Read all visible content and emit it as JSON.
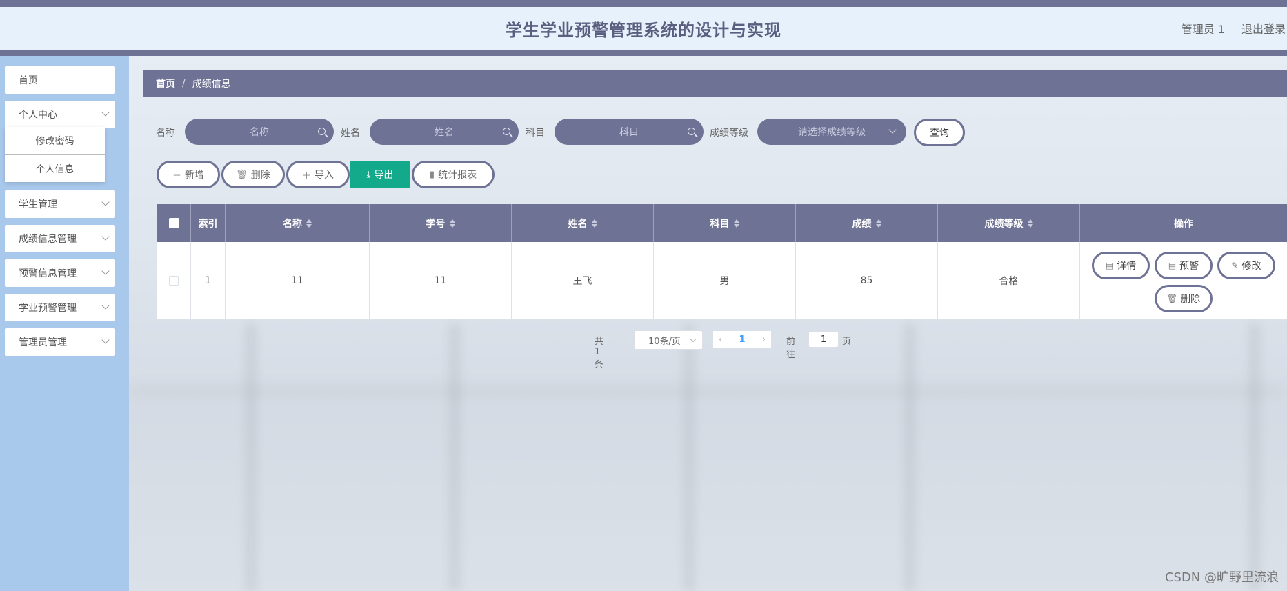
{
  "header": {
    "title": "学生学业预警管理系统的设计与实现",
    "user": "管理员 1",
    "logout": "退出登录"
  },
  "sidebar": {
    "items": [
      {
        "label": "首页"
      },
      {
        "label": "个人中心"
      },
      {
        "label": "学生管理"
      },
      {
        "label": "成绩信息管理"
      },
      {
        "label": "预警信息管理"
      },
      {
        "label": "学业预警管理"
      },
      {
        "label": "管理员管理"
      }
    ],
    "submenu": [
      {
        "label": "修改密码"
      },
      {
        "label": "个人信息"
      }
    ]
  },
  "breadcrumb": {
    "home": "首页",
    "separator": "/",
    "current": "成绩信息"
  },
  "search": {
    "name_label": "名称",
    "name_placeholder": "名称",
    "student_label": "姓名",
    "student_placeholder": "姓名",
    "subject_label": "科目",
    "subject_placeholder": "科目",
    "grade_label": "成绩等级",
    "grade_placeholder": "请选择成绩等级",
    "query": "查询"
  },
  "actions": {
    "add": "新增",
    "delete": "删除",
    "import": "导入",
    "export": "导出",
    "report": "统计报表"
  },
  "table": {
    "headers": [
      "索引",
      "名称",
      "学号",
      "姓名",
      "科目",
      "成绩",
      "成绩等级",
      "操作"
    ],
    "rows": [
      {
        "index": "1",
        "name": "11",
        "student_no": "11",
        "student_name": "王飞",
        "subject": "男",
        "score": "85",
        "level": "合格"
      }
    ],
    "ops": {
      "detail": "详情",
      "warn": "预警",
      "edit": "修改",
      "delete": "删除"
    }
  },
  "pager": {
    "total": "共 1 条",
    "page_size": "10条/页",
    "current_page": "1",
    "goto_label": "前往",
    "goto_value": "1",
    "page_suffix": "页"
  },
  "watermark": "CSDN @旷野里流浪",
  "colors": {
    "accent": "#6e7294",
    "export_green": "#13a98b",
    "sidebar_bg": "#a9c9ec",
    "header_bg": "#e6f1fb"
  }
}
